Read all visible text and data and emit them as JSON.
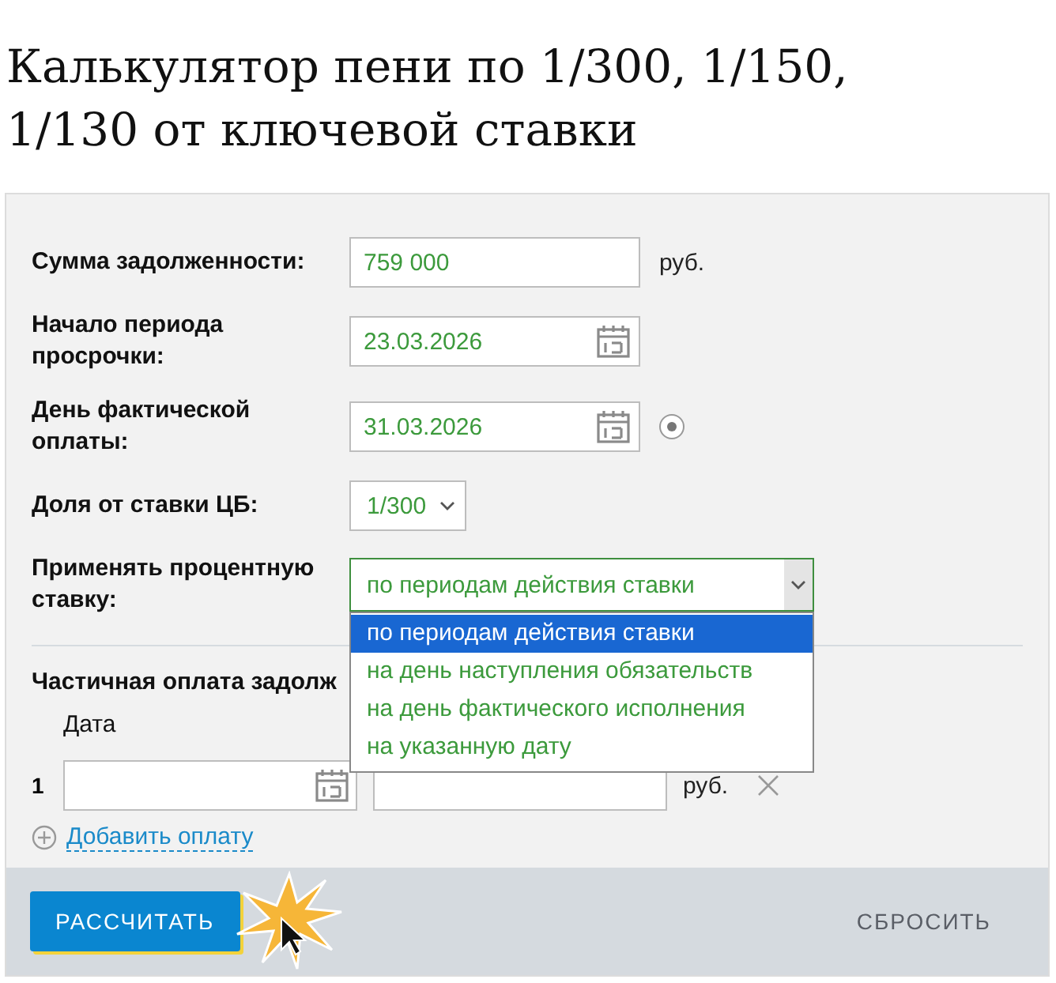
{
  "title": "Калькулятор пени по 1/300, 1/150, 1/130 от ключевой ставки",
  "fields": [
    {
      "kind": "text",
      "label": "Сумма задолженности:",
      "value": "759 000",
      "unit": "руб."
    },
    {
      "kind": "date",
      "label": "Начало периода просрочки:",
      "value": "23.03.2026"
    },
    {
      "kind": "date",
      "label": "День фактической оплаты:",
      "value": "31.03.2026",
      "radio": {
        "selected": true
      }
    },
    {
      "kind": "select",
      "label": "Доля от ставки ЦБ:",
      "value": "1/300"
    },
    {
      "kind": "wide_select",
      "label": "Применять процентную ставку:",
      "value": "по периодам действия ставки",
      "expanded": true,
      "options": [
        {
          "label": "по периодам действия ставки",
          "selected": true
        },
        {
          "label": "на день наступления обязательств",
          "selected": false
        },
        {
          "label": "на день фактического исполнения",
          "selected": false
        },
        {
          "label": "на указанную дату",
          "selected": false
        }
      ]
    }
  ],
  "partial_payment": {
    "title": "Частичная оплата задолж",
    "column_1": "Дата",
    "rows": [
      {
        "number": "1",
        "unit": "руб."
      }
    ],
    "add_link": "Добавить оплату"
  },
  "buttons": {
    "calculate": "РАССЧИТАТЬ",
    "reset": "СБРОСИТЬ"
  }
}
